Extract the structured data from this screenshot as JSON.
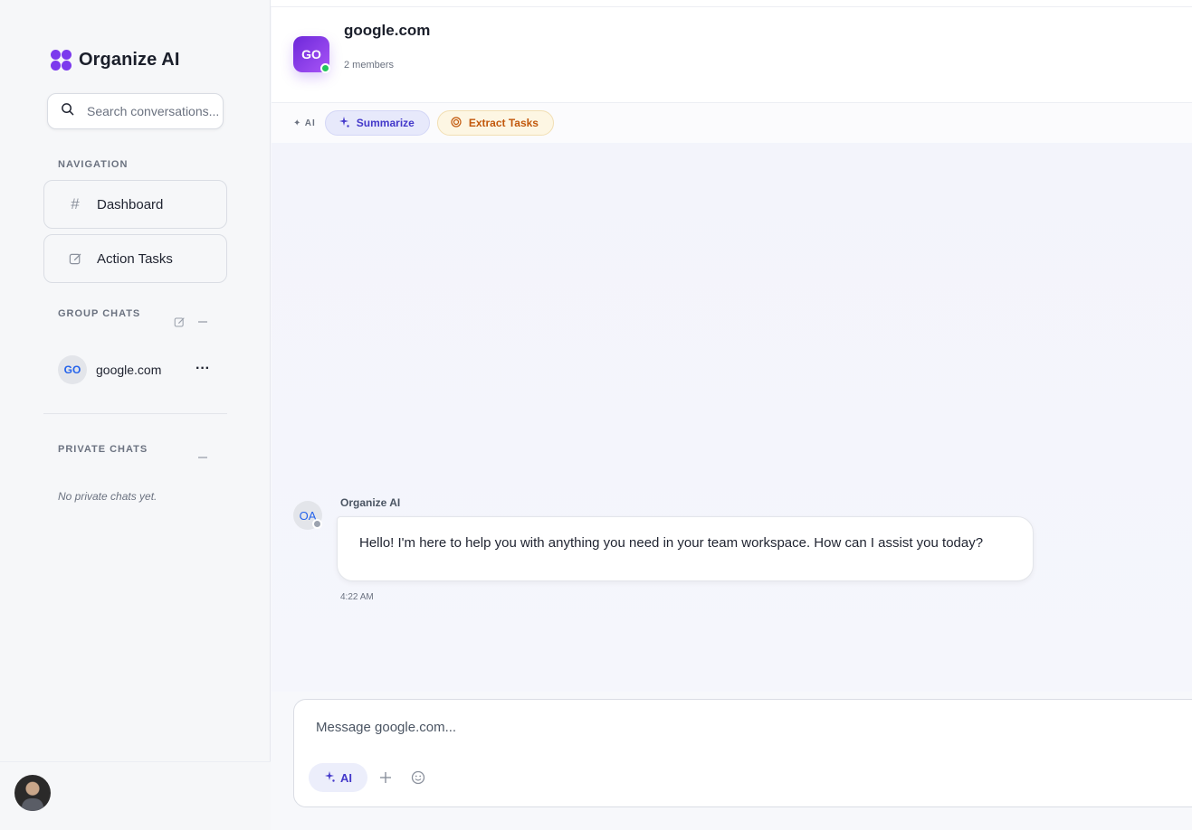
{
  "app": {
    "name": "Organize AI",
    "search_placeholder": "Search conversations..."
  },
  "sidebar": {
    "navigation_label": "NAVIGATION",
    "nav_items": [
      {
        "label": "Dashboard",
        "icon": "hash-icon"
      },
      {
        "label": "Action Tasks",
        "icon": "edit-icon"
      }
    ],
    "group_chats_label": "GROUP CHATS",
    "group_chats": [
      {
        "initials": "GO",
        "name": "google.com"
      }
    ],
    "private_chats_label": "PRIVATE CHATS",
    "private_empty_text": "No private chats yet."
  },
  "chat": {
    "avatar_initials": "GO",
    "title": "google.com",
    "members": "2 members",
    "ai_tag": "✦ AI",
    "actions": [
      {
        "label": "Summarize",
        "icon": "sparkles-icon"
      },
      {
        "label": "Extract Tasks",
        "icon": "target-icon"
      }
    ],
    "messages": [
      {
        "avatar": "OA",
        "sender": "Organize AI",
        "text": "Hello! I'm here to help you with anything you need in your team workspace. How can I assist you today?",
        "time": "4:22 AM"
      }
    ],
    "composer_placeholder": "Message google.com...",
    "ai_button_label": "AI"
  },
  "colors": {
    "accent": "#7c3aed",
    "summarize": "#4338ca",
    "extract": "#c2580c",
    "online": "#22c55e"
  }
}
